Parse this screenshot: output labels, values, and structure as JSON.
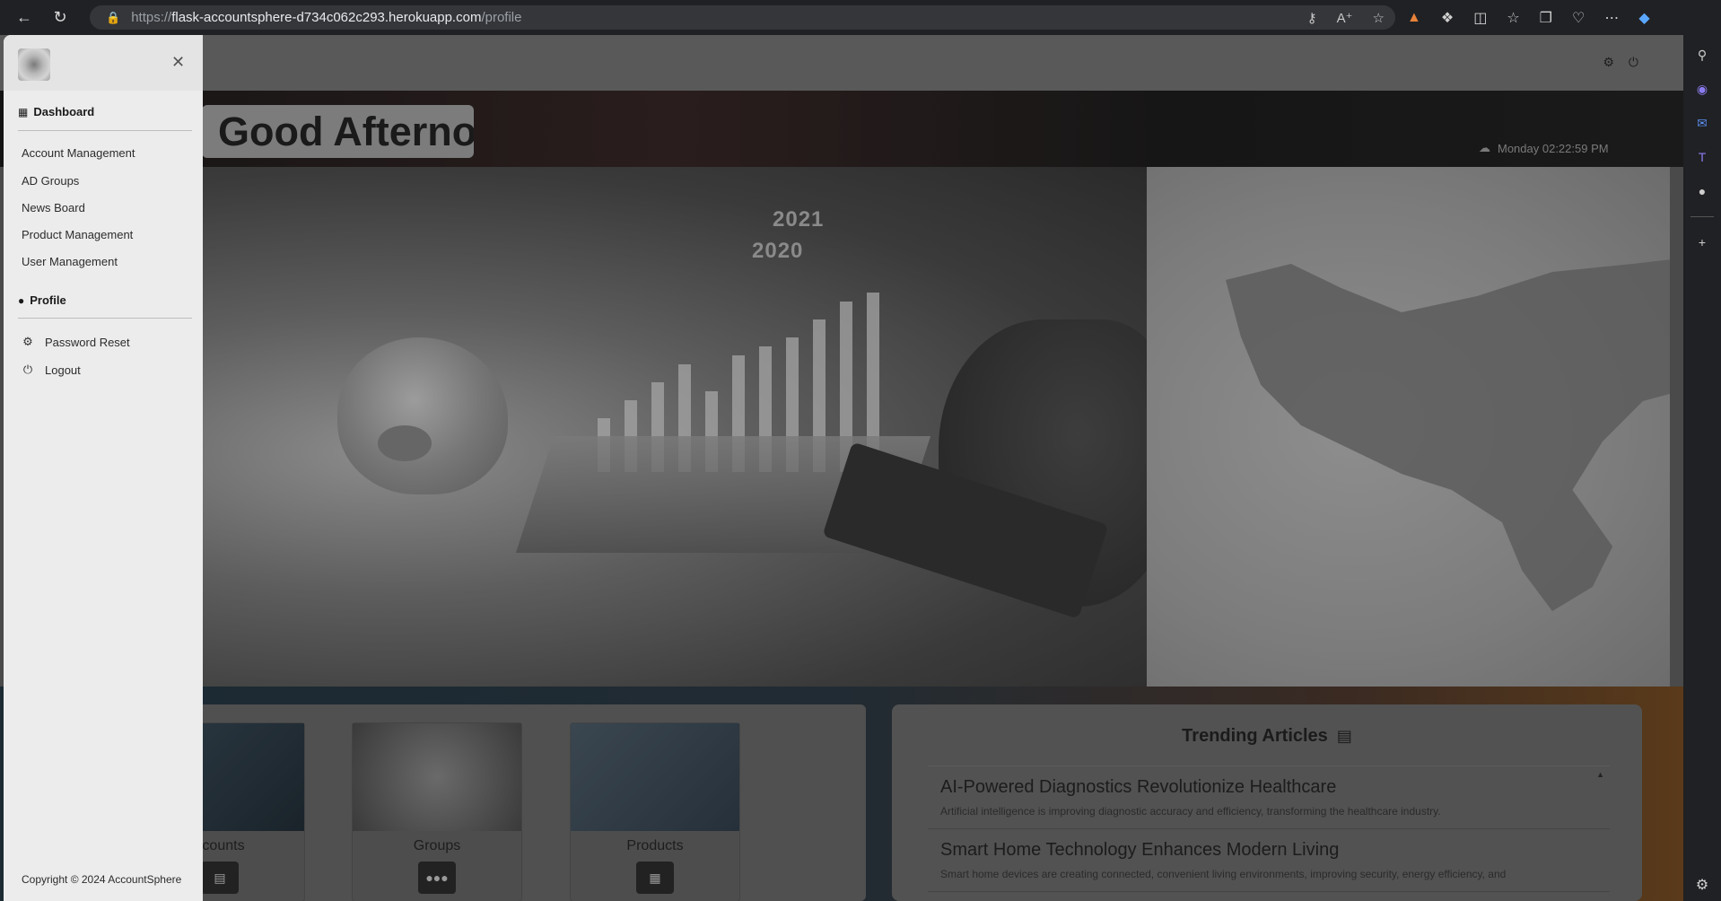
{
  "browser": {
    "url_scheme": "https://",
    "url_host": "flask-accountsphere-d734c062c293.herokuapp.com",
    "url_path": "/profile"
  },
  "drawer": {
    "sections": {
      "dashboard": "Dashboard",
      "profile": "Profile"
    },
    "dashboard_items": [
      "Account Management",
      "AD Groups",
      "News Board",
      "Product Management",
      "User Management"
    ],
    "profile_items": {
      "password_reset": "Password Reset",
      "logout": "Logout"
    },
    "copyright": "Copyright © 2024 AccountSphere"
  },
  "hero": {
    "greeting": "Good Afterno",
    "datetime": "Monday 02:22:59 PM",
    "year_labels": [
      "2021",
      "2020"
    ]
  },
  "cards": [
    {
      "label": "ccounts",
      "icon": "document-icon"
    },
    {
      "label": "Groups",
      "icon": "users-icon"
    },
    {
      "label": "Products",
      "icon": "products-icon"
    }
  ],
  "articles": {
    "title": "Trending Articles",
    "items": [
      {
        "title": "AI-Powered Diagnostics Revolutionize Healthcare",
        "desc": "Artificial intelligence is improving diagnostic accuracy and efficiency, transforming the healthcare industry."
      },
      {
        "title": "Smart Home Technology Enhances Modern Living",
        "desc": "Smart home devices are creating connected, convenient living environments, improving security, energy efficiency, and"
      }
    ]
  },
  "colors": {
    "drawer_bg": "#ececec",
    "page_dim": "#4a4a4a",
    "browser_chrome": "#202124"
  }
}
